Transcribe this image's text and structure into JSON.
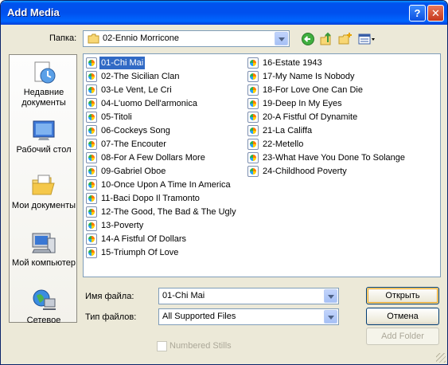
{
  "window": {
    "title": "Add Media"
  },
  "lookin": {
    "label": "Папка:",
    "value": "02-Ennio Morricone"
  },
  "toolbar": {
    "back": "back-arrow-icon",
    "up": "up-folder-icon",
    "new_folder": "new-folder-icon",
    "views": "views-menu-icon"
  },
  "places": [
    {
      "label": "Недавние документы",
      "icon": "recent-documents-icon"
    },
    {
      "label": "Рабочий стол",
      "icon": "desktop-icon"
    },
    {
      "label": "Мои документы",
      "icon": "my-documents-icon"
    },
    {
      "label": "Мой компьютер",
      "icon": "my-computer-icon"
    },
    {
      "label": "Сетевое",
      "icon": "network-icon"
    }
  ],
  "files": [
    "01-Chi Mai",
    "02-The Sicilian Clan",
    "03-Le Vent, Le Cri",
    "04-L'uomo Dell'armonica",
    "05-Titoli",
    "06-Cockeys Song",
    "07-The Encouter",
    "08-For A Few Dollars More",
    "09-Gabriel Oboe",
    "10-Once Upon A Time In America",
    "11-Baci Dopo Il Tramonto",
    "12-The Good, The Bad & The Ugly",
    "13-Poverty",
    "14-A Fistful Of Dollars",
    "15-Triumph Of Love",
    "16-Estate 1943",
    "17-My Name Is Nobody",
    "18-For Love One Can Die",
    "19-Deep In My Eyes",
    "20-A Fistful Of Dynamite",
    "21-La Califfa",
    "22-Metello",
    "23-What Have You Done To Solange",
    "24-Childhood Poverty"
  ],
  "selected_file": "01-Chi Mai",
  "filename": {
    "label": "Имя файла:",
    "value": "01-Chi Mai"
  },
  "filetype": {
    "label": "Тип файлов:",
    "value": "All Supported Files"
  },
  "buttons": {
    "open": "Открыть",
    "cancel": "Отмена",
    "add_folder": "Add Folder"
  },
  "numbered_stills": {
    "label": "Numbered Stills",
    "checked": false
  }
}
